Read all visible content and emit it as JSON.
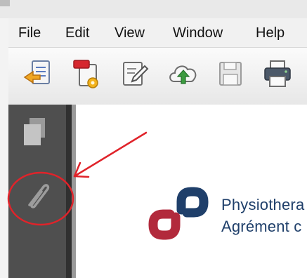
{
  "menu": {
    "items": [
      "File",
      "Edit",
      "View",
      "Window",
      "Help"
    ]
  },
  "toolbar": {
    "buttons": [
      {
        "icon": "create-pdf-icon"
      },
      {
        "icon": "combine-files-icon"
      },
      {
        "icon": "edit-document-icon"
      },
      {
        "icon": "upload-cloud-icon"
      },
      {
        "icon": "save-icon"
      },
      {
        "icon": "print-icon"
      }
    ]
  },
  "navigation_pane": {
    "buttons": [
      {
        "icon": "pages-icon"
      },
      {
        "icon": "attachments-paperclip-icon"
      }
    ]
  },
  "document": {
    "logo_line_1": "Physiothera",
    "logo_line_2": "Agrément c"
  },
  "colors": {
    "logo_navy": "#1f3f6a",
    "logo_crimson": "#b22a3c",
    "annotation_red": "#e0232a",
    "nav_pane": "#4f4f4f",
    "upload_green": "#3b9b3f"
  }
}
